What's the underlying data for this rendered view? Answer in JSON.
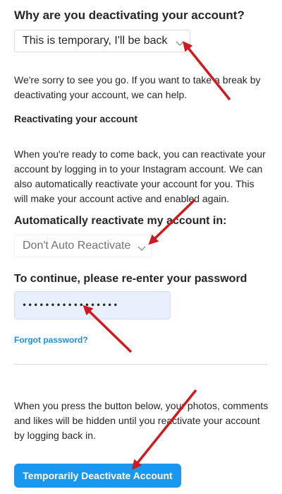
{
  "deactivation": {
    "question": "Why are you deactivating your account?",
    "reason_selected": "This is temporary, I'll be back",
    "intro": "We're sorry to see you go. If you want to take a break by deactivating your account, we can help.",
    "reactivating_heading": "Reactivating your account",
    "reactivating_text": "When you're ready to come back, you can reactivate your account by logging in to your Instagram account. We can also automatically reactivate your account for you. This will make your account active and enabled again.",
    "auto_label": "Automatically reactivate my account in:",
    "auto_selected": "Don't Auto Reactivate",
    "password_label": "To continue, please re-enter your password",
    "password_value": "•••••••••••••••••",
    "forgot_link": "Forgot password?",
    "warning": "When you press the button below, your photos, comments and likes will be hidden until you reactivate your account by logging back in.",
    "button_label": "Temporarily Deactivate Account"
  },
  "icons": {
    "dropdown": "chevron-down-icon",
    "annotation": "arrow-annotation"
  },
  "colors": {
    "button": "#1a98ef",
    "link": "#1d8fd6",
    "password_field": "#e8f0fe",
    "annotation_arrow": "#d0191f"
  }
}
